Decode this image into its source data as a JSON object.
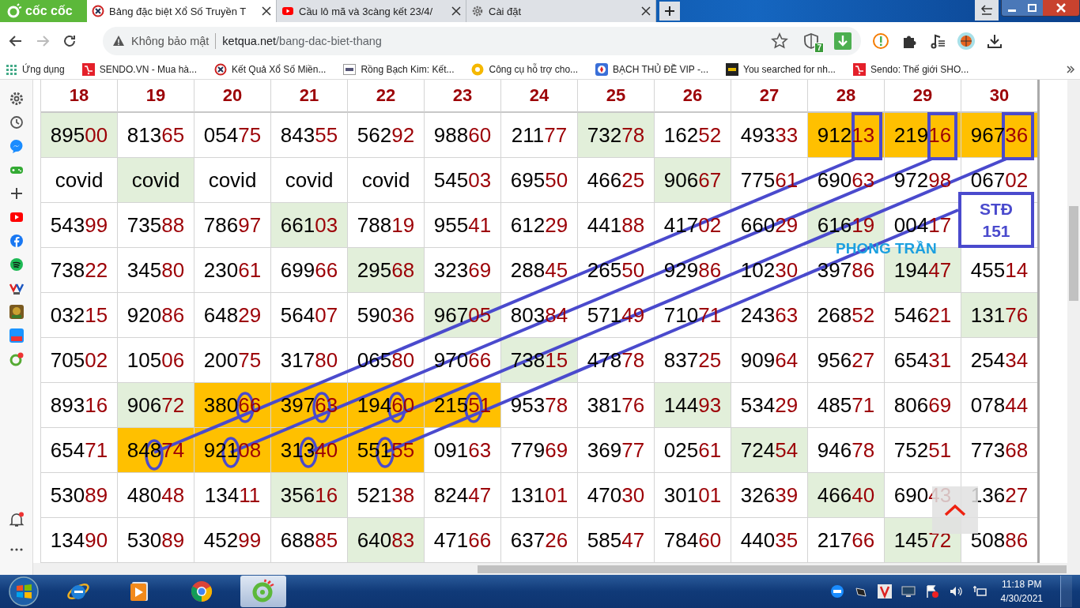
{
  "browser": {
    "brand": "cốc cốc",
    "tabs": [
      {
        "title": "Bảng đặc biệt Xổ Số Truyền T",
        "selected": true
      },
      {
        "title": "Cầu lô mã và 3càng kết 23/4/",
        "selected": false
      },
      {
        "title": "Cài đặt",
        "selected": false
      }
    ],
    "security": "Không bảo mật",
    "url_host": "ketqua.net",
    "url_path": "/bang-dac-biet-thang",
    "shield_badge": "7",
    "bookmarks": [
      {
        "label": "Ứng dụng"
      },
      {
        "label": "SENDO.VN - Mua hà..."
      },
      {
        "label": "Kết Quả Xổ Số Miền..."
      },
      {
        "label": "Rồng Bạch Kim: Kết..."
      },
      {
        "label": "Công cụ hỗ trợ cho..."
      },
      {
        "label": "BẠCH THỦ ĐỀ VIP -..."
      },
      {
        "label": "You searched for nh..."
      },
      {
        "label": "Sendo: Thế giới SHO..."
      }
    ]
  },
  "table": {
    "columns": [
      "18",
      "19",
      "20",
      "21",
      "22",
      "23",
      "24",
      "25",
      "26",
      "27",
      "28",
      "29",
      "30"
    ],
    "rows": [
      [
        {
          "kind": "number",
          "text": "89500",
          "color": "#e2efda"
        },
        {
          "kind": "number",
          "text": "81365",
          "color": "#ffffff"
        },
        {
          "kind": "number",
          "text": "05475",
          "color": "#ffffff"
        },
        {
          "kind": "number",
          "text": "84355",
          "color": "#ffffff"
        },
        {
          "kind": "number",
          "text": "56292",
          "color": "#ffffff"
        },
        {
          "kind": "number",
          "text": "98860",
          "color": "#ffffff"
        },
        {
          "kind": "number",
          "text": "21177",
          "color": "#ffffff"
        },
        {
          "kind": "number",
          "text": "73278",
          "color": "#e2efda"
        },
        {
          "kind": "number",
          "text": "16252",
          "color": "#ffffff"
        },
        {
          "kind": "number",
          "text": "49333",
          "color": "#ffffff"
        },
        {
          "kind": "number",
          "text": "91213",
          "color": "#ffc000"
        },
        {
          "kind": "number",
          "text": "21916",
          "color": "#ffc000"
        },
        {
          "kind": "number",
          "text": "96736",
          "color": "#ffc000"
        }
      ],
      [
        {
          "kind": "word",
          "text": "covid",
          "color": "#ffffff"
        },
        {
          "kind": "word",
          "text": "covid",
          "color": "#e2efda"
        },
        {
          "kind": "word",
          "text": "covid",
          "color": "#ffffff"
        },
        {
          "kind": "word",
          "text": "covid",
          "color": "#ffffff"
        },
        {
          "kind": "word",
          "text": "covid",
          "color": "#ffffff"
        },
        {
          "kind": "number",
          "text": "54503",
          "color": "#ffffff"
        },
        {
          "kind": "number",
          "text": "69550",
          "color": "#ffffff"
        },
        {
          "kind": "number",
          "text": "46625",
          "color": "#ffffff"
        },
        {
          "kind": "number",
          "text": "90667",
          "color": "#e2efda"
        },
        {
          "kind": "number",
          "text": "77561",
          "color": "#ffffff"
        },
        {
          "kind": "number",
          "text": "69063",
          "color": "#ffffff"
        },
        {
          "kind": "number",
          "text": "97298",
          "color": "#ffffff"
        },
        {
          "kind": "number",
          "text": "06702",
          "color": "#ffffff"
        }
      ],
      [
        {
          "kind": "number",
          "text": "54399",
          "color": "#ffffff"
        },
        {
          "kind": "number",
          "text": "73588",
          "color": "#ffffff"
        },
        {
          "kind": "number",
          "text": "78697",
          "color": "#ffffff"
        },
        {
          "kind": "number",
          "text": "66103",
          "color": "#e2efda"
        },
        {
          "kind": "number",
          "text": "78819",
          "color": "#ffffff"
        },
        {
          "kind": "number",
          "text": "95541",
          "color": "#ffffff"
        },
        {
          "kind": "number",
          "text": "61229",
          "color": "#ffffff"
        },
        {
          "kind": "number",
          "text": "44188",
          "color": "#ffffff"
        },
        {
          "kind": "number",
          "text": "41702",
          "color": "#ffffff"
        },
        {
          "kind": "number",
          "text": "66029",
          "color": "#ffffff"
        },
        {
          "kind": "number",
          "text": "61619",
          "color": "#e2efda"
        },
        {
          "kind": "number",
          "text": "00417",
          "color": "#ffffff"
        },
        {
          "kind": "blank"
        }
      ],
      [
        {
          "kind": "number",
          "text": "73822",
          "color": "#ffffff"
        },
        {
          "kind": "number",
          "text": "34580",
          "color": "#ffffff"
        },
        {
          "kind": "number",
          "text": "23061",
          "color": "#ffffff"
        },
        {
          "kind": "number",
          "text": "69966",
          "color": "#ffffff"
        },
        {
          "kind": "number",
          "text": "29568",
          "color": "#e2efda"
        },
        {
          "kind": "number",
          "text": "32369",
          "color": "#ffffff"
        },
        {
          "kind": "number",
          "text": "28845",
          "color": "#ffffff"
        },
        {
          "kind": "number",
          "text": "26550",
          "color": "#ffffff"
        },
        {
          "kind": "number",
          "text": "92986",
          "color": "#ffffff"
        },
        {
          "kind": "number",
          "text": "10230",
          "color": "#ffffff"
        },
        {
          "kind": "number",
          "text": "39786",
          "color": "#ffffff"
        },
        {
          "kind": "number",
          "text": "19447",
          "color": "#e2efda"
        },
        {
          "kind": "number",
          "text": "45514",
          "color": "#ffffff"
        }
      ],
      [
        {
          "kind": "number",
          "text": "03215",
          "color": "#ffffff"
        },
        {
          "kind": "number",
          "text": "92086",
          "color": "#ffffff"
        },
        {
          "kind": "number",
          "text": "64829",
          "color": "#ffffff"
        },
        {
          "kind": "number",
          "text": "56407",
          "color": "#ffffff"
        },
        {
          "kind": "number",
          "text": "59036",
          "color": "#ffffff"
        },
        {
          "kind": "number",
          "text": "96705",
          "color": "#e2efda"
        },
        {
          "kind": "number",
          "text": "80384",
          "color": "#ffffff"
        },
        {
          "kind": "number",
          "text": "57149",
          "color": "#ffffff"
        },
        {
          "kind": "number",
          "text": "71071",
          "color": "#ffffff"
        },
        {
          "kind": "number",
          "text": "24363",
          "color": "#ffffff"
        },
        {
          "kind": "number",
          "text": "26852",
          "color": "#ffffff"
        },
        {
          "kind": "number",
          "text": "54621",
          "color": "#ffffff"
        },
        {
          "kind": "number",
          "text": "13176",
          "color": "#e2efda"
        }
      ],
      [
        {
          "kind": "number",
          "text": "70502",
          "color": "#ffffff"
        },
        {
          "kind": "number",
          "text": "10506",
          "color": "#ffffff"
        },
        {
          "kind": "number",
          "text": "20075",
          "color": "#ffffff"
        },
        {
          "kind": "number",
          "text": "31780",
          "color": "#ffffff"
        },
        {
          "kind": "number",
          "text": "06580",
          "color": "#ffffff"
        },
        {
          "kind": "number",
          "text": "97066",
          "color": "#ffffff"
        },
        {
          "kind": "number",
          "text": "73815",
          "color": "#e2efda"
        },
        {
          "kind": "number",
          "text": "47878",
          "color": "#ffffff"
        },
        {
          "kind": "number",
          "text": "83725",
          "color": "#ffffff"
        },
        {
          "kind": "number",
          "text": "90964",
          "color": "#ffffff"
        },
        {
          "kind": "number",
          "text": "95627",
          "color": "#ffffff"
        },
        {
          "kind": "number",
          "text": "65431",
          "color": "#ffffff"
        },
        {
          "kind": "number",
          "text": "25434",
          "color": "#ffffff"
        }
      ],
      [
        {
          "kind": "number",
          "text": "89316",
          "color": "#ffffff"
        },
        {
          "kind": "number",
          "text": "90672",
          "color": "#e2efda"
        },
        {
          "kind": "number",
          "text": "38066",
          "color": "#ffc000"
        },
        {
          "kind": "number",
          "text": "39763",
          "color": "#ffc000"
        },
        {
          "kind": "number",
          "text": "19460",
          "color": "#ffc000"
        },
        {
          "kind": "number",
          "text": "21551",
          "color": "#ffc000"
        },
        {
          "kind": "number",
          "text": "95378",
          "color": "#ffffff"
        },
        {
          "kind": "number",
          "text": "38176",
          "color": "#ffffff"
        },
        {
          "kind": "number",
          "text": "14493",
          "color": "#e2efda"
        },
        {
          "kind": "number",
          "text": "53429",
          "color": "#ffffff"
        },
        {
          "kind": "number",
          "text": "48571",
          "color": "#ffffff"
        },
        {
          "kind": "number",
          "text": "80669",
          "color": "#ffffff"
        },
        {
          "kind": "number",
          "text": "07844",
          "color": "#ffffff"
        }
      ],
      [
        {
          "kind": "number",
          "text": "65471",
          "color": "#ffffff"
        },
        {
          "kind": "number",
          "text": "84874",
          "color": "#ffc000"
        },
        {
          "kind": "number",
          "text": "92108",
          "color": "#ffc000"
        },
        {
          "kind": "number",
          "text": "31340",
          "color": "#ffc000"
        },
        {
          "kind": "number",
          "text": "55155",
          "color": "#ffc000"
        },
        {
          "kind": "number",
          "text": "09163",
          "color": "#ffffff"
        },
        {
          "kind": "number",
          "text": "77969",
          "color": "#ffffff"
        },
        {
          "kind": "number",
          "text": "36977",
          "color": "#ffffff"
        },
        {
          "kind": "number",
          "text": "02561",
          "color": "#ffffff"
        },
        {
          "kind": "number",
          "text": "72454",
          "color": "#e2efda"
        },
        {
          "kind": "number",
          "text": "94678",
          "color": "#ffffff"
        },
        {
          "kind": "number",
          "text": "75251",
          "color": "#ffffff"
        },
        {
          "kind": "number",
          "text": "77368",
          "color": "#ffffff"
        }
      ],
      [
        {
          "kind": "number",
          "text": "53089",
          "color": "#ffffff"
        },
        {
          "kind": "number",
          "text": "48048",
          "color": "#ffffff"
        },
        {
          "kind": "number",
          "text": "13411",
          "color": "#ffffff"
        },
        {
          "kind": "number",
          "text": "35616",
          "color": "#e2efda"
        },
        {
          "kind": "number",
          "text": "52138",
          "color": "#ffffff"
        },
        {
          "kind": "number",
          "text": "82447",
          "color": "#ffffff"
        },
        {
          "kind": "number",
          "text": "13101",
          "color": "#ffffff"
        },
        {
          "kind": "number",
          "text": "47030",
          "color": "#ffffff"
        },
        {
          "kind": "number",
          "text": "30101",
          "color": "#ffffff"
        },
        {
          "kind": "number",
          "text": "32639",
          "color": "#ffffff"
        },
        {
          "kind": "number",
          "text": "46640",
          "color": "#e2efda"
        },
        {
          "kind": "number",
          "text": "69043",
          "color": "#ffffff"
        },
        {
          "kind": "number",
          "text": "13627",
          "color": "#ffffff"
        }
      ],
      [
        {
          "kind": "number",
          "text": "13490",
          "color": "#ffffff"
        },
        {
          "kind": "number",
          "text": "53089",
          "color": "#ffffff"
        },
        {
          "kind": "number",
          "text": "45299",
          "color": "#ffffff"
        },
        {
          "kind": "number",
          "text": "68885",
          "color": "#ffffff"
        },
        {
          "kind": "number",
          "text": "64083",
          "color": "#e2efda"
        },
        {
          "kind": "number",
          "text": "47166",
          "color": "#ffffff"
        },
        {
          "kind": "number",
          "text": "63726",
          "color": "#ffffff"
        },
        {
          "kind": "number",
          "text": "58547",
          "color": "#ffffff"
        },
        {
          "kind": "number",
          "text": "78460",
          "color": "#ffffff"
        },
        {
          "kind": "number",
          "text": "44035",
          "color": "#ffffff"
        },
        {
          "kind": "number",
          "text": "21766",
          "color": "#ffffff"
        },
        {
          "kind": "number",
          "text": "14572",
          "color": "#e2efda"
        },
        {
          "kind": "number",
          "text": "50886",
          "color": "#ffffff"
        }
      ]
    ]
  },
  "annotation": {
    "box_title": "STĐ",
    "box_value": "151",
    "signature": "PHONG TRẦN"
  },
  "taskbar": {
    "apps": [
      {
        "selected": false
      },
      {
        "selected": false
      },
      {
        "selected": false
      },
      {
        "selected": true
      }
    ],
    "time": "11:18 PM",
    "date": "4/30/2021"
  }
}
